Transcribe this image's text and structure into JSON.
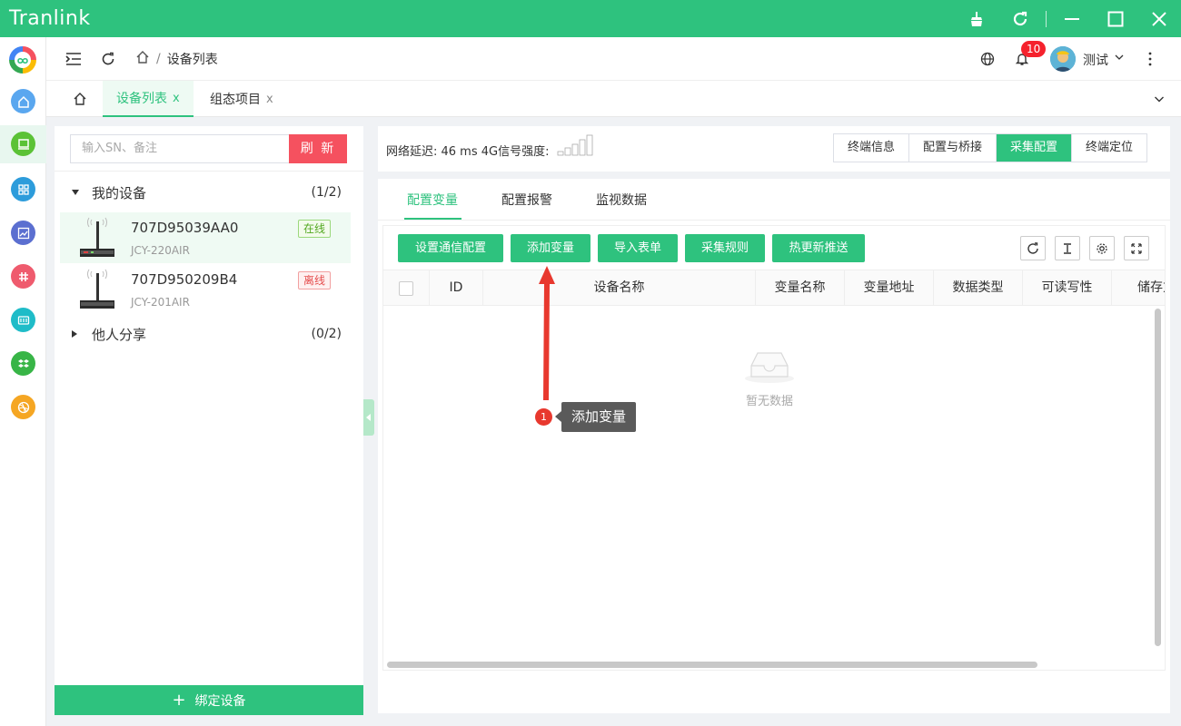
{
  "app": {
    "title": "Tranlink"
  },
  "header": {
    "breadcrumb_current": "设备列表",
    "breadcrumb_sep": "/",
    "notif_count": "10",
    "username": "测试"
  },
  "tabs": [
    {
      "label": "设备列表",
      "close": "x"
    },
    {
      "label": "组态项目",
      "close": "x"
    }
  ],
  "left": {
    "search_placeholder": "输入SN、备注",
    "refresh_label": "刷 新",
    "my_devices": {
      "label": "我的设备",
      "count": "(1/2)"
    },
    "devices": [
      {
        "sn": "707D95039AA0",
        "model": "JCY-220AIR",
        "status": "在线"
      },
      {
        "sn": "707D950209B4",
        "model": "JCY-201AIR",
        "status": "离线"
      }
    ],
    "shared": {
      "label": "他人分享",
      "count": "(0/2)"
    },
    "bind_label": "绑定设备",
    "bind_plus": "+"
  },
  "info": {
    "net_text": "网络延迟: 46 ms 4G信号强度:",
    "segments": [
      "终端信息",
      "配置与桥接",
      "采集配置",
      "终端定位"
    ],
    "active_segment": 2
  },
  "main": {
    "subtabs": [
      "配置变量",
      "配置报警",
      "监视数据"
    ],
    "buttons": [
      "设置通信配置",
      "添加变量",
      "导入表单",
      "采集规则",
      "热更新推送"
    ],
    "columns": [
      "ID",
      "设备名称",
      "变量名称",
      "变量地址",
      "数据类型",
      "可读写性",
      "储存方"
    ],
    "empty_text": "暂无数据"
  },
  "annotation": {
    "step": "1",
    "label": "添加变量"
  },
  "colors": {
    "brand": "#2ec27e",
    "danger": "#f5515f",
    "annotation": "#e8382e"
  }
}
